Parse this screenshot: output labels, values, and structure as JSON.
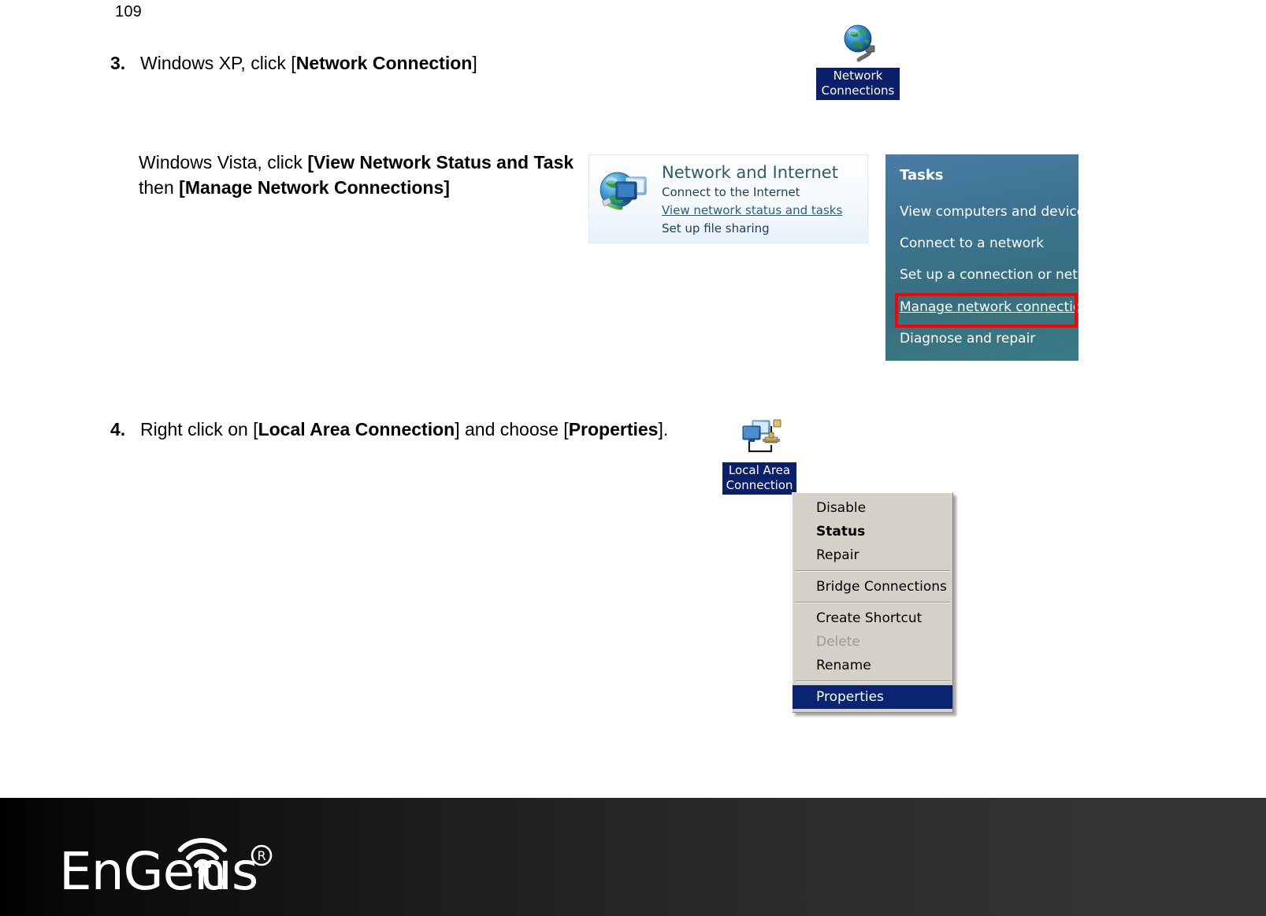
{
  "page": {
    "number": "109"
  },
  "steps": [
    {
      "num": "3.",
      "text_prefix": "Windows XP, click [",
      "text_bold": "Network Connection",
      "text_suffix": "]"
    },
    {
      "num": "4.",
      "text_prefix": "Right click on [",
      "text_bold": "Local Area Connection",
      "text_mid": "] and choose [",
      "text_bold2": "Properties",
      "text_suffix": "]."
    }
  ],
  "vista_instruction": {
    "line1_prefix": "Windows Vista, click ",
    "line1_bold": "[View Network Status and Task",
    "line2_prefix": "then ",
    "line2_bold": "[Manage Network Connections]"
  },
  "xp_icon": {
    "label_line1": "Network",
    "label_line2": "Connections",
    "icon_name": "network-connections-globe-icon",
    "selection_color": "#0b1f6b"
  },
  "vista_card": {
    "title": "Network and Internet",
    "items": [
      "Connect to the Internet",
      "View network status and tasks",
      "Set up file sharing"
    ],
    "link_index": 1,
    "title_color": "#2e5c69",
    "link_color": "#2a5f88"
  },
  "tasks_pane": {
    "heading": "Tasks",
    "items": [
      "View computers and devices",
      "Connect to a network",
      "Set up a connection or network",
      "Manage network connections",
      "Diagnose and repair"
    ],
    "highlighted_item": "Manage network connections",
    "highlight_color": "#ff0000",
    "background_top": "#4a7ca6",
    "background_bottom": "#3a7a86"
  },
  "lac_icon": {
    "label_line1": "Local Area",
    "label_line2": "Connection",
    "icon_name": "local-area-connection-icon",
    "selection_color": "#0b1f6b"
  },
  "context_menu": {
    "items": [
      {
        "label": "Disable",
        "type": "item",
        "state": "normal"
      },
      {
        "label": "Status",
        "type": "item",
        "state": "bold"
      },
      {
        "label": "Repair",
        "type": "item",
        "state": "normal"
      },
      {
        "label": "",
        "type": "separator",
        "state": ""
      },
      {
        "label": "Bridge Connections",
        "type": "item",
        "state": "normal"
      },
      {
        "label": "",
        "type": "separator",
        "state": ""
      },
      {
        "label": "Create Shortcut",
        "type": "item",
        "state": "normal"
      },
      {
        "label": "Delete",
        "type": "item",
        "state": "disabled"
      },
      {
        "label": "Rename",
        "type": "item",
        "state": "normal"
      },
      {
        "label": "",
        "type": "separator",
        "state": ""
      },
      {
        "label": "Properties",
        "type": "item",
        "state": "selected"
      }
    ],
    "background": "#d5d1c8",
    "selected_background": "#0b2472"
  },
  "footer": {
    "brand": "EnGenius",
    "trademark": "®",
    "background_left": "#000000",
    "background_right": "#333333"
  }
}
